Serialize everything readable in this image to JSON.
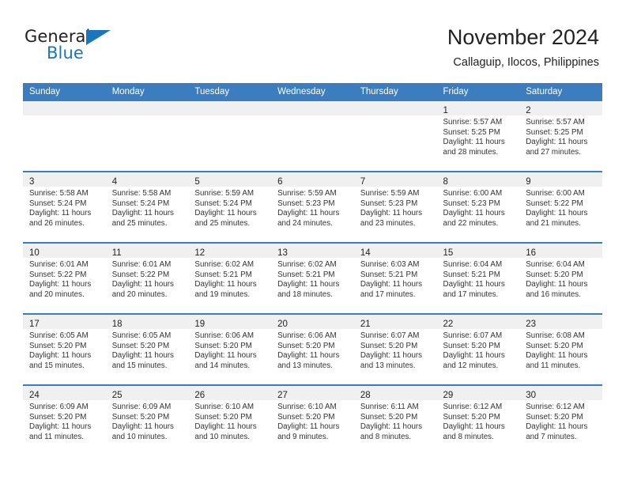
{
  "brand": {
    "name_part1": "General",
    "name_part2": "Blue",
    "accent_color": "#1b75bb"
  },
  "header": {
    "title": "November 2024",
    "subtitle": "Callaguip, Ilocos, Philippines"
  },
  "theme": {
    "header_row_color": "#3c7dc0",
    "day_band_color": "#f0f0f0",
    "text_color": "#222222"
  },
  "calendar": {
    "weekday_headers": [
      "Sunday",
      "Monday",
      "Tuesday",
      "Wednesday",
      "Thursday",
      "Friday",
      "Saturday"
    ],
    "weeks": [
      [
        {
          "day": "",
          "empty": true
        },
        {
          "day": "",
          "empty": true
        },
        {
          "day": "",
          "empty": true
        },
        {
          "day": "",
          "empty": true
        },
        {
          "day": "",
          "empty": true
        },
        {
          "day": "1",
          "sunrise": "Sunrise: 5:57 AM",
          "sunset": "Sunset: 5:25 PM",
          "daylight": "Daylight: 11 hours and 28 minutes."
        },
        {
          "day": "2",
          "sunrise": "Sunrise: 5:57 AM",
          "sunset": "Sunset: 5:25 PM",
          "daylight": "Daylight: 11 hours and 27 minutes."
        }
      ],
      [
        {
          "day": "3",
          "sunrise": "Sunrise: 5:58 AM",
          "sunset": "Sunset: 5:24 PM",
          "daylight": "Daylight: 11 hours and 26 minutes."
        },
        {
          "day": "4",
          "sunrise": "Sunrise: 5:58 AM",
          "sunset": "Sunset: 5:24 PM",
          "daylight": "Daylight: 11 hours and 25 minutes."
        },
        {
          "day": "5",
          "sunrise": "Sunrise: 5:59 AM",
          "sunset": "Sunset: 5:24 PM",
          "daylight": "Daylight: 11 hours and 25 minutes."
        },
        {
          "day": "6",
          "sunrise": "Sunrise: 5:59 AM",
          "sunset": "Sunset: 5:23 PM",
          "daylight": "Daylight: 11 hours and 24 minutes."
        },
        {
          "day": "7",
          "sunrise": "Sunrise: 5:59 AM",
          "sunset": "Sunset: 5:23 PM",
          "daylight": "Daylight: 11 hours and 23 minutes."
        },
        {
          "day": "8",
          "sunrise": "Sunrise: 6:00 AM",
          "sunset": "Sunset: 5:23 PM",
          "daylight": "Daylight: 11 hours and 22 minutes."
        },
        {
          "day": "9",
          "sunrise": "Sunrise: 6:00 AM",
          "sunset": "Sunset: 5:22 PM",
          "daylight": "Daylight: 11 hours and 21 minutes."
        }
      ],
      [
        {
          "day": "10",
          "sunrise": "Sunrise: 6:01 AM",
          "sunset": "Sunset: 5:22 PM",
          "daylight": "Daylight: 11 hours and 20 minutes."
        },
        {
          "day": "11",
          "sunrise": "Sunrise: 6:01 AM",
          "sunset": "Sunset: 5:22 PM",
          "daylight": "Daylight: 11 hours and 20 minutes."
        },
        {
          "day": "12",
          "sunrise": "Sunrise: 6:02 AM",
          "sunset": "Sunset: 5:21 PM",
          "daylight": "Daylight: 11 hours and 19 minutes."
        },
        {
          "day": "13",
          "sunrise": "Sunrise: 6:02 AM",
          "sunset": "Sunset: 5:21 PM",
          "daylight": "Daylight: 11 hours and 18 minutes."
        },
        {
          "day": "14",
          "sunrise": "Sunrise: 6:03 AM",
          "sunset": "Sunset: 5:21 PM",
          "daylight": "Daylight: 11 hours and 17 minutes."
        },
        {
          "day": "15",
          "sunrise": "Sunrise: 6:04 AM",
          "sunset": "Sunset: 5:21 PM",
          "daylight": "Daylight: 11 hours and 17 minutes."
        },
        {
          "day": "16",
          "sunrise": "Sunrise: 6:04 AM",
          "sunset": "Sunset: 5:20 PM",
          "daylight": "Daylight: 11 hours and 16 minutes."
        }
      ],
      [
        {
          "day": "17",
          "sunrise": "Sunrise: 6:05 AM",
          "sunset": "Sunset: 5:20 PM",
          "daylight": "Daylight: 11 hours and 15 minutes."
        },
        {
          "day": "18",
          "sunrise": "Sunrise: 6:05 AM",
          "sunset": "Sunset: 5:20 PM",
          "daylight": "Daylight: 11 hours and 15 minutes."
        },
        {
          "day": "19",
          "sunrise": "Sunrise: 6:06 AM",
          "sunset": "Sunset: 5:20 PM",
          "daylight": "Daylight: 11 hours and 14 minutes."
        },
        {
          "day": "20",
          "sunrise": "Sunrise: 6:06 AM",
          "sunset": "Sunset: 5:20 PM",
          "daylight": "Daylight: 11 hours and 13 minutes."
        },
        {
          "day": "21",
          "sunrise": "Sunrise: 6:07 AM",
          "sunset": "Sunset: 5:20 PM",
          "daylight": "Daylight: 11 hours and 13 minutes."
        },
        {
          "day": "22",
          "sunrise": "Sunrise: 6:07 AM",
          "sunset": "Sunset: 5:20 PM",
          "daylight": "Daylight: 11 hours and 12 minutes."
        },
        {
          "day": "23",
          "sunrise": "Sunrise: 6:08 AM",
          "sunset": "Sunset: 5:20 PM",
          "daylight": "Daylight: 11 hours and 11 minutes."
        }
      ],
      [
        {
          "day": "24",
          "sunrise": "Sunrise: 6:09 AM",
          "sunset": "Sunset: 5:20 PM",
          "daylight": "Daylight: 11 hours and 11 minutes."
        },
        {
          "day": "25",
          "sunrise": "Sunrise: 6:09 AM",
          "sunset": "Sunset: 5:20 PM",
          "daylight": "Daylight: 11 hours and 10 minutes."
        },
        {
          "day": "26",
          "sunrise": "Sunrise: 6:10 AM",
          "sunset": "Sunset: 5:20 PM",
          "daylight": "Daylight: 11 hours and 10 minutes."
        },
        {
          "day": "27",
          "sunrise": "Sunrise: 6:10 AM",
          "sunset": "Sunset: 5:20 PM",
          "daylight": "Daylight: 11 hours and 9 minutes."
        },
        {
          "day": "28",
          "sunrise": "Sunrise: 6:11 AM",
          "sunset": "Sunset: 5:20 PM",
          "daylight": "Daylight: 11 hours and 8 minutes."
        },
        {
          "day": "29",
          "sunrise": "Sunrise: 6:12 AM",
          "sunset": "Sunset: 5:20 PM",
          "daylight": "Daylight: 11 hours and 8 minutes."
        },
        {
          "day": "30",
          "sunrise": "Sunrise: 6:12 AM",
          "sunset": "Sunset: 5:20 PM",
          "daylight": "Daylight: 11 hours and 7 minutes."
        }
      ]
    ]
  }
}
